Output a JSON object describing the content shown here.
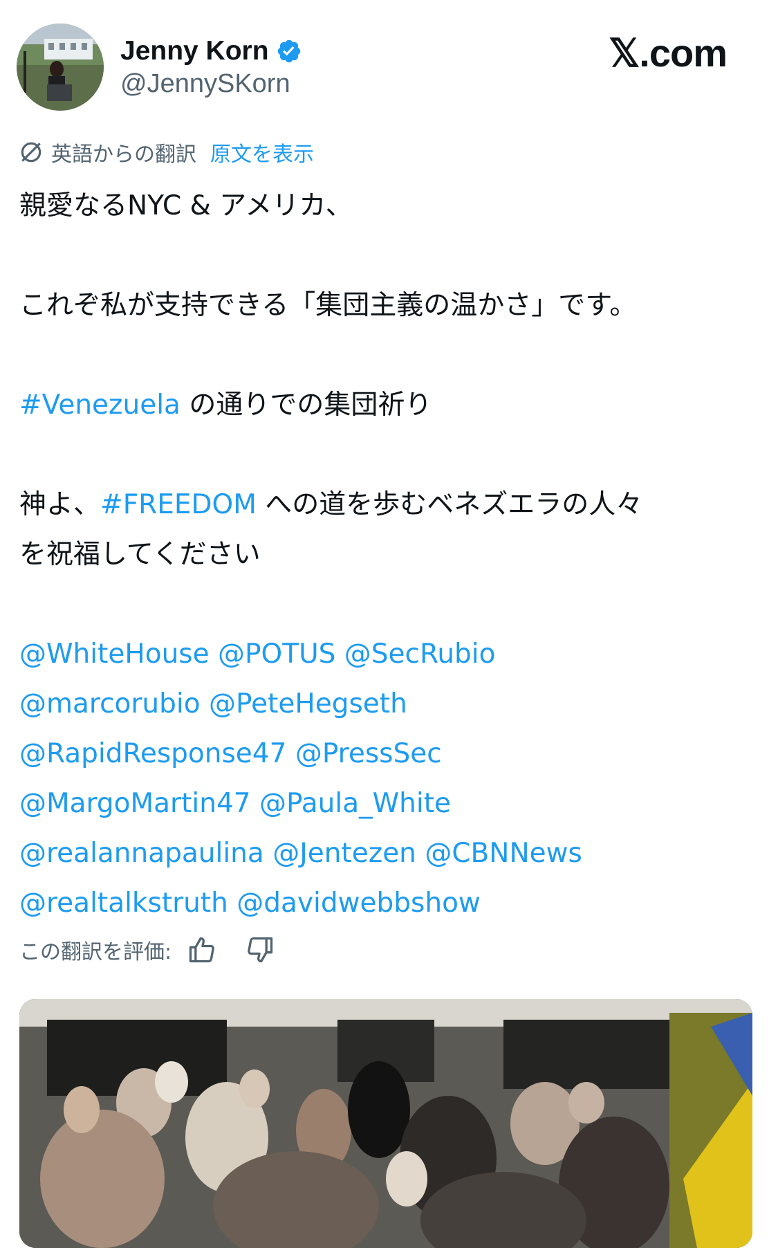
{
  "site_logo": "𝕏.com",
  "author": {
    "display_name": "Jenny Korn",
    "handle": "@JennySKorn",
    "verified": true,
    "verified_color": "#1d9bf0"
  },
  "translation": {
    "icon": "translate-icon",
    "translated_from": "英語からの翻訳",
    "show_original": "原文を表示"
  },
  "tweet": {
    "line1": "親愛なるNYC & アメリカ、",
    "line2": "これぞ私が支持できる「集団主義の温かさ」です。",
    "line3_tag": "#Venezuela",
    "line3_rest": " の通りでの集団祈り",
    "line4_pre": "神よ、",
    "line4_tag": "#FREEDOM",
    "line4_rest": " への道を歩むベネズエラの人々",
    "line5": "を祝福してください",
    "mentions": [
      [
        "@WhiteHouse",
        "@POTUS",
        "@SecRubio"
      ],
      [
        "@marcorubio",
        "@PeteHegseth"
      ],
      [
        "@RapidResponse47",
        "@PressSec"
      ],
      [
        "@MargoMartin47",
        "@Paula_White"
      ],
      [
        "@realannapaulina",
        "@Jentezen",
        "@CBNNews"
      ],
      [
        "@realtalkstruth",
        "@davidwebbshow"
      ]
    ]
  },
  "rate_translation": {
    "label": "この翻訳を評価:",
    "thumbs_up_icon": "thumbs-up-icon",
    "thumbs_down_icon": "thumbs-down-icon"
  },
  "colors": {
    "link": "#1d9bf0",
    "secondary_text": "#536471",
    "primary_text": "#0f1419"
  }
}
